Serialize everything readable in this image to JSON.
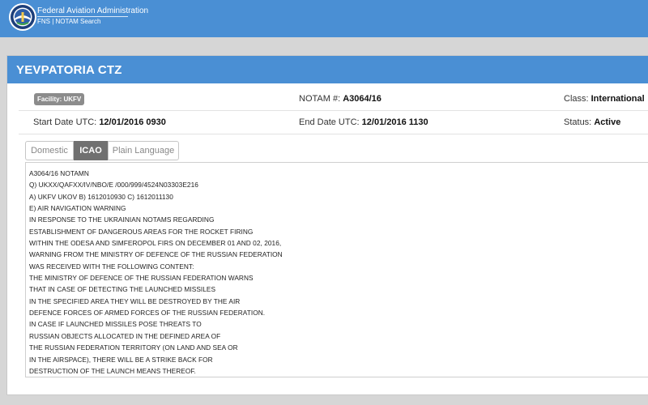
{
  "topbar": {
    "org_name": "Federal Aviation Administration",
    "app_name": "FNS | NOTAM Search"
  },
  "notam": {
    "title": "YEVPATORIA CTZ",
    "facility_label": "Facility:",
    "facility_value": "UKFV",
    "number_label": "NOTAM #:",
    "number_value": "A3064/16",
    "class_label": "Class:",
    "class_value": "International",
    "start_label": "Start Date UTC:",
    "start_value": "12/01/2016 0930",
    "end_label": "End Date UTC:",
    "end_value": "12/01/2016 1130",
    "status_label": "Status:",
    "status_value": "Active"
  },
  "tabs": {
    "items": [
      {
        "label": "Domestic"
      },
      {
        "label": "ICAO"
      },
      {
        "label": "Plain Language"
      }
    ],
    "active": "ICAO"
  },
  "icao_text": [
    "A3064/16 NOTAMN",
    "Q) UKXX/QAFXX/IV/NBO/E /000/999/4524N03303E216",
    "A) UKFV UKOV B) 1612010930 C) 1612011130",
    "E) AIR NAVIGATION WARNING",
    "IN RESPONSE TO THE UKRAINIAN NOTAMS REGARDING",
    "ESTABLISHMENT OF DANGEROUS AREAS FOR THE ROCKET FIRING",
    "WITHIN THE ODESA AND SIMFEROPOL FIRS ON DECEMBER 01 AND 02, 2016,",
    "WARNING FROM THE MINISTRY OF DEFENCE OF THE RUSSIAN FEDERATION",
    "WAS RECEIVED WITH THE FOLLOWING CONTENT:",
    "THE MINISTRY OF DEFENCE OF THE RUSSIAN FEDERATION WARNS",
    "THAT IN CASE OF DETECTING THE LAUNCHED MISSILES",
    "IN THE SPECIFIED AREA THEY WILL BE DESTROYED BY THE AIR",
    "DEFENCE FORCES OF ARMED FORCES OF THE RUSSIAN FEDERATION.",
    "IN CASE IF LAUNCHED MISSILES POSE THREATS TO",
    "RUSSIAN OBJECTS ALLOCATED IN THE DEFINED AREA OF",
    "THE RUSSIAN FEDERATION TERRITORY (ON LAND AND SEA OR",
    "IN THE AIRSPACE), THERE WILL BE A STRIKE BACK FOR",
    "DESTRUCTION OF THE LAUNCH MEANS THEREOF."
  ],
  "colors": {
    "brand_blue": "#4a8fd4",
    "active_tab": "#707070",
    "badge": "#8c8c8c"
  },
  "icons": {
    "logo": "faa-seal-icon"
  }
}
